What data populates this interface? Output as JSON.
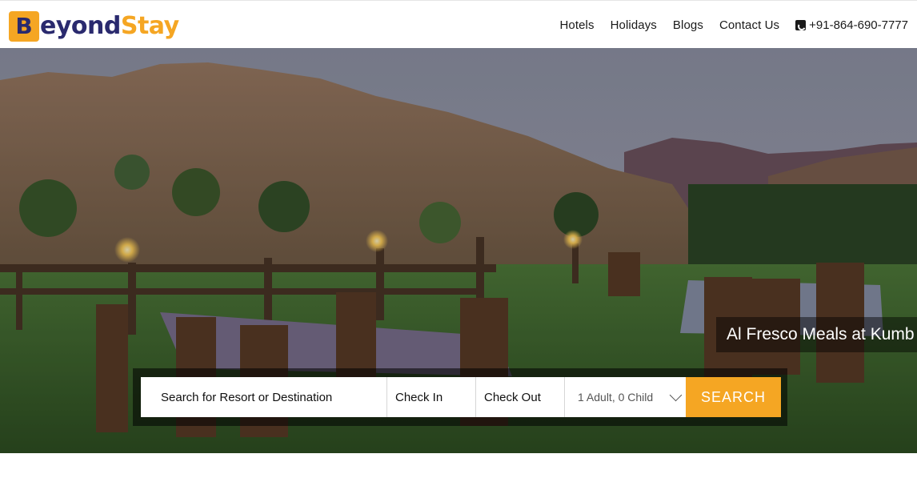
{
  "header": {
    "logo_letter": "B",
    "logo_part1": "eyond",
    "logo_part2": "Stay",
    "nav": [
      {
        "label": "Hotels"
      },
      {
        "label": "Holidays"
      },
      {
        "label": "Blogs"
      },
      {
        "label": "Contact Us"
      }
    ],
    "phone": "+91-864-690-7777"
  },
  "hero": {
    "caption": "Al Fresco Meals at Kumb"
  },
  "search": {
    "destination_placeholder": "Search for Resort or Destination",
    "check_in_label": "Check In",
    "check_out_label": "Check Out",
    "guests_value": "1 Adult, 0 Child",
    "button_label": "SEARCH"
  },
  "colors": {
    "brand_orange": "#f5a623",
    "brand_navy": "#2a2a6e"
  }
}
